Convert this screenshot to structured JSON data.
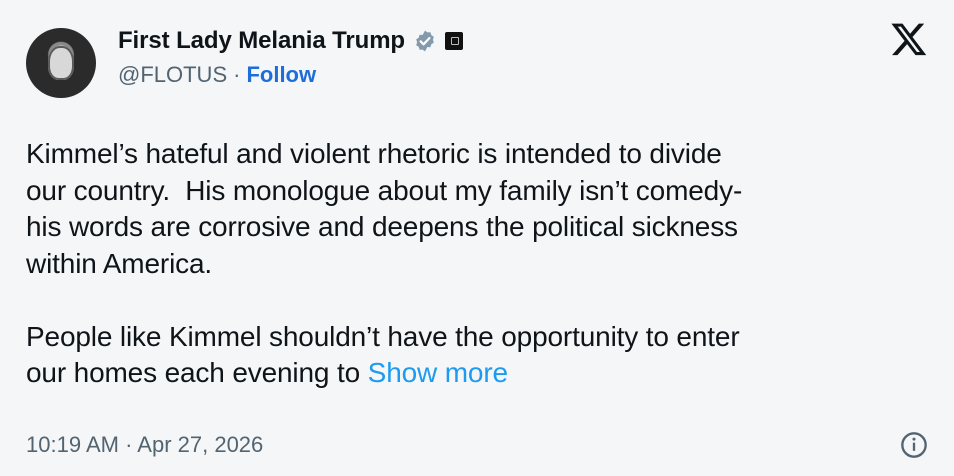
{
  "author": {
    "display_name": "First Lady Melania Trump",
    "handle": "@FLOTUS",
    "separator": "·",
    "follow_label": "Follow",
    "verified_icon": "verified-badge-icon",
    "affiliation_icon": "affiliation-badge-icon"
  },
  "post": {
    "text_line1": "Kimmel’s hateful and violent rhetoric is intended to divide\nour country.  His monologue about my family isn’t comedy-\nhis words are corrosive and deepens the political sickness\nwithin America.\n\nPeople like Kimmel shouldn’t have the opportunity to enter\nour homes each evening to ",
    "show_more_label": "Show more"
  },
  "footer": {
    "timestamp": "10:19 AM · Apr 27, 2026",
    "info_icon": "info-icon"
  },
  "brand": {
    "logo_icon": "x-logo-icon",
    "link_color": "#1d9bf0",
    "follow_color": "#1d6ed8",
    "verified_color": "#829aab"
  }
}
